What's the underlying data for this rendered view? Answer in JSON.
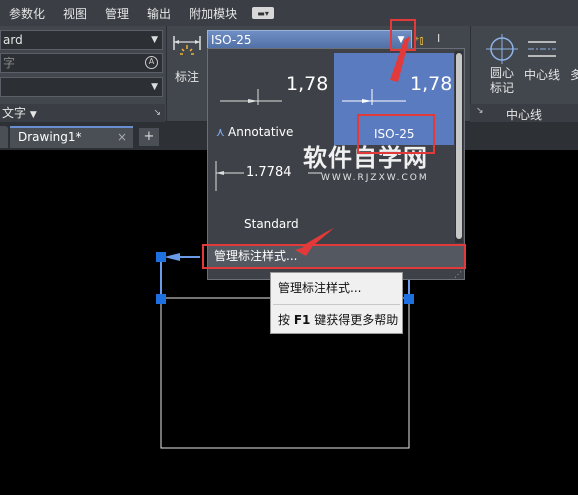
{
  "menubar": {
    "items": [
      "参数化",
      "视图",
      "管理",
      "输出",
      "附加模块"
    ]
  },
  "left_panel": {
    "style_value": "ard",
    "search_placeholder": "字",
    "bottom_label": "文字"
  },
  "dimension_panel": {
    "label": "标注",
    "current_style": "ISO-25"
  },
  "gallery": {
    "cells": [
      {
        "value": "1,78",
        "name": ""
      },
      {
        "value": "1,78",
        "name": "ISO-25"
      },
      {
        "value": "",
        "name": "Annotative"
      },
      {
        "value": "1.7784",
        "name": "Standard"
      }
    ],
    "footer": "管理标注样式..."
  },
  "centerline_panel": {
    "center_mark_label_1": "圆心",
    "center_mark_label_2": "标记",
    "centerline_label": "中心线",
    "panel_title": "中心线",
    "more_label": "多"
  },
  "tabs": {
    "drawing_name": "Drawing1*",
    "close_glyph": "×",
    "add_glyph": "+"
  },
  "context_menu": {
    "item1": "管理标注样式...",
    "item2_prefix": "按 ",
    "item2_key": "F1",
    "item2_suffix": " 键获得更多帮助"
  },
  "watermark": {
    "title": "软件自学网",
    "url": "WWW.RJZXW.COM"
  },
  "colors": {
    "annotation_red": "#e23a3a",
    "selected_blue": "#5a7bbf",
    "grip_blue": "#1e6fe0"
  }
}
